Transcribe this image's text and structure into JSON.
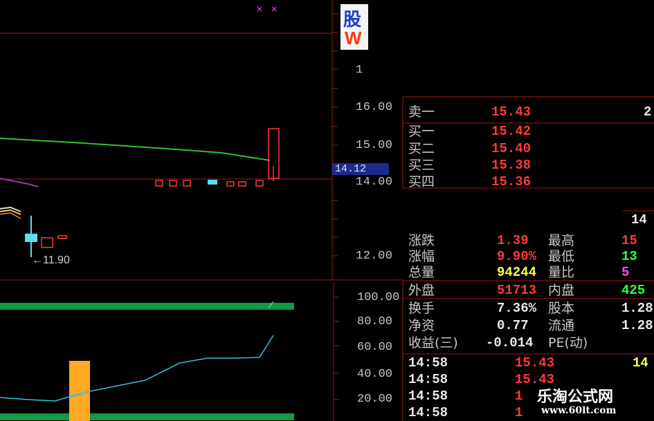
{
  "logo": {
    "char": "股",
    "sub": "W"
  },
  "price_axis": {
    "ticks": [
      "16.00",
      "15.00",
      "14.00",
      "12.00"
    ],
    "partial_tick": "1"
  },
  "current_price_label": "14.12",
  "low_marker": "←11.90",
  "indicator_axis": {
    "ticks": [
      "100.00",
      "80.00",
      "60.00",
      "40.00",
      "20.00"
    ]
  },
  "order_book": {
    "sell": [
      {
        "label": "卖一",
        "price": "15.43",
        "volume": "2"
      }
    ],
    "buy": [
      {
        "label": "买一",
        "price": "15.42"
      },
      {
        "label": "买二",
        "price": "15.40"
      },
      {
        "label": "买三",
        "price": "15.38"
      },
      {
        "label": "买四",
        "price": "15.36"
      }
    ]
  },
  "quote_top_right": "14",
  "stats": [
    {
      "label1": "涨跌",
      "val1": "1.39",
      "label2": "最高",
      "val2": "15",
      "c1": "red",
      "c2": "red"
    },
    {
      "label1": "涨幅",
      "val1": "9.90%",
      "label2": "最低",
      "val2": "13",
      "c1": "red",
      "c2": "green"
    },
    {
      "label1": "总量",
      "val1": "94244",
      "label2": "量比",
      "val2": "5",
      "c1": "yellow",
      "c2": "magenta"
    },
    {
      "label1": "外盘",
      "val1": "51713",
      "label2": "内盘",
      "val2": "425",
      "c1": "red",
      "c2": "green"
    },
    {
      "label1": "换手",
      "val1": "7.36%",
      "label2": "股本",
      "val2": "1.28",
      "c1": "white",
      "c2": "white"
    },
    {
      "label1": "净资",
      "val1": "0.77",
      "label2": "流通",
      "val2": "1.28",
      "c1": "white",
      "c2": "white"
    },
    {
      "label1": "收益(三)",
      "val1": "-0.014",
      "label2": "PE(动)",
      "val2": "",
      "c1": "white",
      "c2": "white"
    }
  ],
  "ticks_list": [
    {
      "time": "14:58",
      "price": "15.43",
      "vol": "14"
    },
    {
      "time": "14:58",
      "price": "15.43",
      "vol": ""
    },
    {
      "time": "14:58",
      "price": "1",
      "vol": ""
    },
    {
      "time": "14:58",
      "price": "1",
      "vol": ""
    }
  ],
  "watermark": {
    "title": "乐淘公式网",
    "url": "www.60lt.com"
  },
  "colors": {
    "grid": "#a01818",
    "ma_green": "#30c030",
    "ma_purple": "#9a3aa8",
    "candle_red": "#ff3a3a",
    "candle_cyan": "#58e0f0",
    "indicator_line": "#3ac0d8",
    "band_green": "#119944",
    "volume_bar": "#ffaa22"
  }
}
